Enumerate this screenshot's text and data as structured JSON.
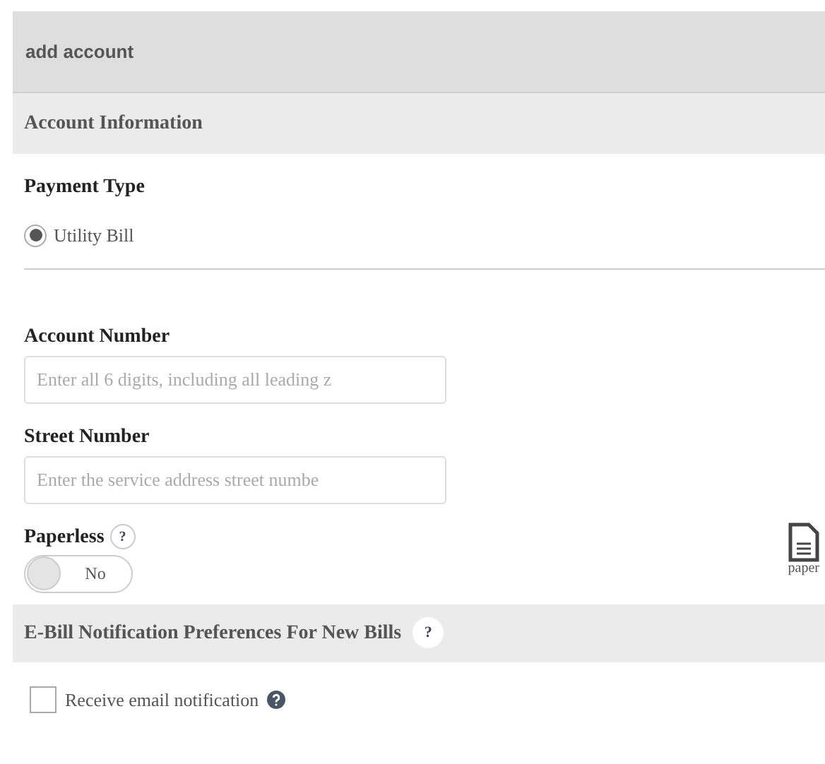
{
  "header": {
    "title": "add account"
  },
  "section": {
    "title": "Account Information"
  },
  "payment_type": {
    "label": "Payment Type",
    "options": [
      {
        "label": "Utility Bill",
        "selected": true
      }
    ]
  },
  "fields": [
    {
      "label": "Account Number",
      "placeholder": "Enter all 6 digits, including all leading z"
    },
    {
      "label": "Street Number",
      "placeholder": "Enter the service address street numbe"
    }
  ],
  "paperless": {
    "label": "Paperless",
    "help": "?",
    "toggle": {
      "on": false,
      "text": "No"
    },
    "paper_label": "paper"
  },
  "ebill": {
    "title": "E-Bill Notification Preferences For New Bills",
    "help": "?",
    "checkbox": {
      "label": "Receive email notification",
      "checked": false
    }
  }
}
